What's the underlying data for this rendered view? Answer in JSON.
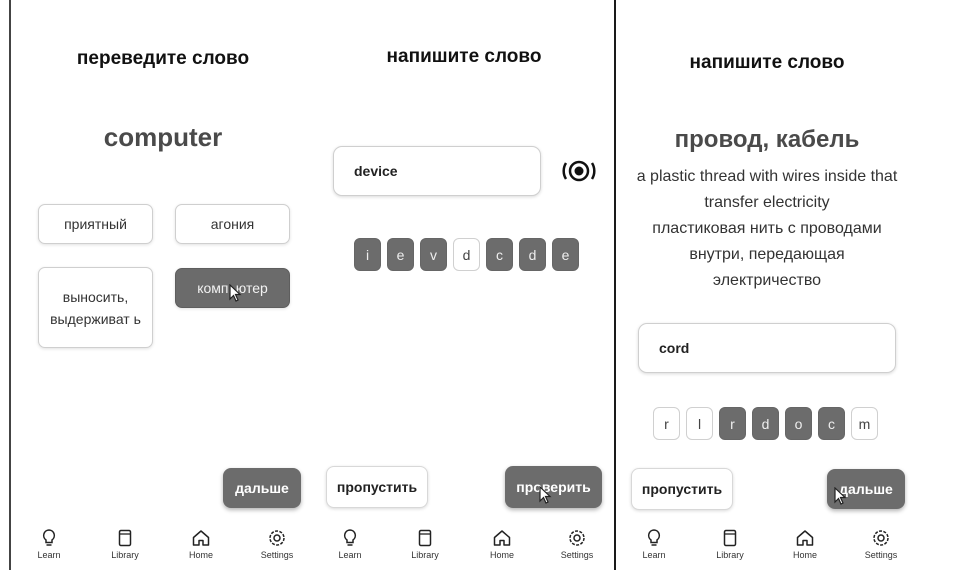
{
  "screen1": {
    "heading": "переведите слово",
    "word": "computer",
    "options": [
      {
        "label": "приятный",
        "selected": false
      },
      {
        "label": "агония",
        "selected": false
      },
      {
        "label": "выносить, выдерживат ь",
        "selected": false
      },
      {
        "label": "компьютер",
        "selected": true
      }
    ],
    "next_button": "дальше",
    "nav": [
      "Learn",
      "Library",
      "Home",
      "Settings"
    ]
  },
  "screen2": {
    "heading": "напишите слово",
    "input_value": "device",
    "speaker_icon": "sound-icon",
    "tiles": [
      {
        "letter": "i",
        "used": true
      },
      {
        "letter": "e",
        "used": true
      },
      {
        "letter": "v",
        "used": true
      },
      {
        "letter": "d",
        "used": false
      },
      {
        "letter": "c",
        "used": true
      },
      {
        "letter": "d",
        "used": true
      },
      {
        "letter": "e",
        "used": true
      }
    ],
    "skip_button": "пропустить",
    "check_button": "проверить",
    "nav": [
      "Learn",
      "Library",
      "Home",
      "Settings"
    ]
  },
  "screen3": {
    "heading": "напишите слово",
    "word": "провод, кабель",
    "definition_en_1": "a plastic thread with wires inside that",
    "definition_en_2": "transfer electricity",
    "definition_ru_1": "пластиковая нить с проводами",
    "definition_ru_2": "внутри, передающая",
    "definition_ru_3": "электричество",
    "input_value": "cord",
    "tiles": [
      {
        "letter": "r",
        "used": false
      },
      {
        "letter": "l",
        "used": false
      },
      {
        "letter": "r",
        "used": true
      },
      {
        "letter": "d",
        "used": true
      },
      {
        "letter": "o",
        "used": true
      },
      {
        "letter": "c",
        "used": true
      },
      {
        "letter": "m",
        "used": false
      }
    ],
    "skip_button": "пропустить",
    "next_button": "дальше",
    "nav": [
      "Learn",
      "Library",
      "Home",
      "Settings"
    ]
  },
  "colors": {
    "selected": "#6b6b6b",
    "text": "#222222",
    "background": "#ffffff"
  }
}
